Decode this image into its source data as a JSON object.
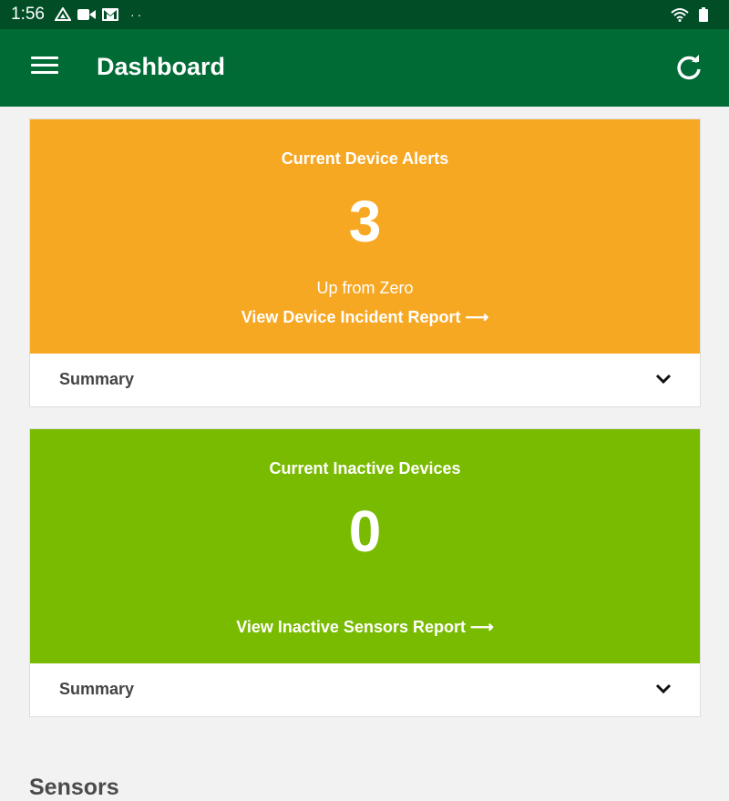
{
  "status_bar": {
    "time": "1:56",
    "icons": [
      "drive-icon",
      "video-camera-icon",
      "gmail-icon"
    ],
    "dots": "··",
    "right_icons": [
      "wifi-icon",
      "battery-icon"
    ]
  },
  "app_bar": {
    "title": "Dashboard",
    "color": "#006b35",
    "left_icon": "hamburger-menu-icon",
    "right_icon": "refresh-icon"
  },
  "cards": [
    {
      "title": "Current Device Alerts",
      "number": "3",
      "subtitle": "Up from Zero",
      "link": "View Device Incident Report ⟶",
      "summary": "Summary",
      "color": "#f7a823"
    },
    {
      "title": "Current Inactive Devices",
      "number": "0",
      "subtitle": "",
      "link": "View Inactive Sensors Report ⟶",
      "summary": "Summary",
      "color": "#79bb00"
    }
  ],
  "sections": {
    "sensors_heading": "Sensors"
  }
}
